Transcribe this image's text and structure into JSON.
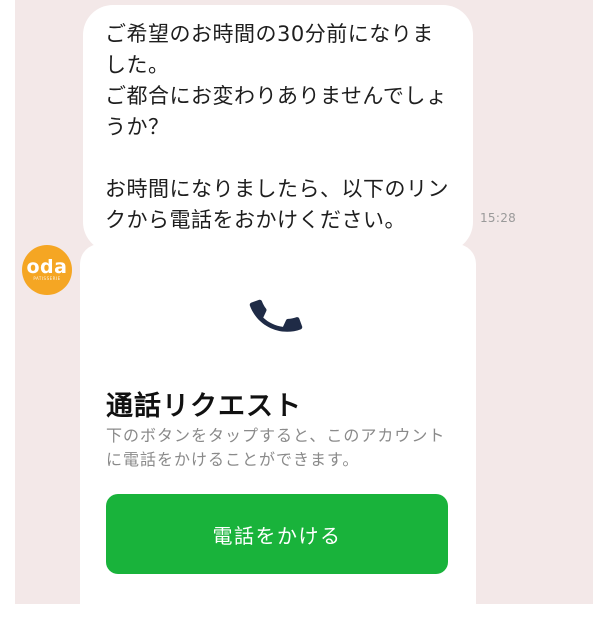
{
  "message": {
    "lines": [
      "ご希望のお時間の30分前になりました。",
      "ご都合にお変わりありませんでしょうか？",
      "お時間になりましたら、以下のリンクから電話をおかけください。"
    ],
    "timestamp": "15:28"
  },
  "avatar": {
    "brand": "oda",
    "sub": "PATISSERIE"
  },
  "card": {
    "icon": "phone-icon",
    "title": "通話リクエスト",
    "description": "下のボタンをタップすると、このアカウントに電話をかけることができます。",
    "button_label": "電話をかける"
  },
  "colors": {
    "chat_background": "#f3e8e8",
    "avatar": "#f5a623",
    "button": "#19b33b",
    "phone_icon": "#1f2b46"
  }
}
